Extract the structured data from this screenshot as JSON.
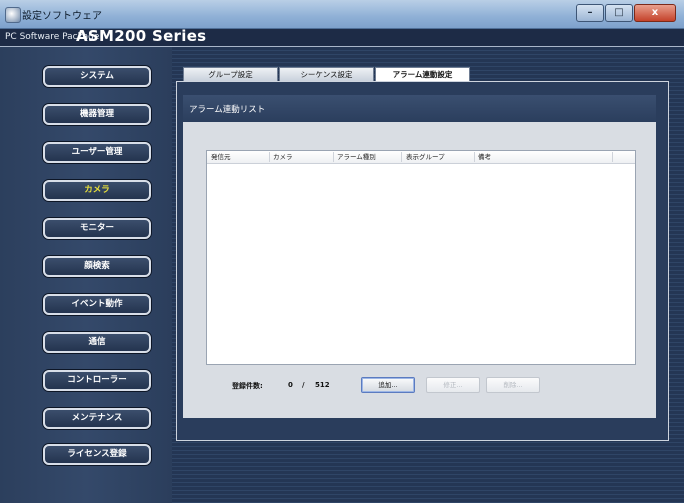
{
  "window": {
    "title": "設定ソフトウェア",
    "buttons": {
      "minimize": "–",
      "maximize": "□",
      "close": "x"
    }
  },
  "header": {
    "small": "PC Software Package",
    "big": "ASM200 Series"
  },
  "sidebar": {
    "items": [
      {
        "label": "システム"
      },
      {
        "label": "機器管理"
      },
      {
        "label": "ユーザー管理"
      },
      {
        "label": "カメラ",
        "active": true
      },
      {
        "label": "モニター"
      },
      {
        "label": "顔検索"
      },
      {
        "label": "イベント動作"
      },
      {
        "label": "通信"
      },
      {
        "label": "コントローラー"
      },
      {
        "label": "メンテナンス"
      },
      {
        "label": "ライセンス登録"
      }
    ],
    "active_color": "#e9e03a"
  },
  "tabs": [
    {
      "label": "グループ設定"
    },
    {
      "label": "シーケンス設定"
    },
    {
      "label": "アラーム連動設定",
      "active": true
    }
  ],
  "panel": {
    "title": "アラーム連動リスト",
    "columns": [
      "発信元",
      "カメラ",
      "アラーム種別",
      "表示グループ",
      "備考"
    ],
    "rows": [],
    "registered_label": "登録件数:",
    "registered_count": "0",
    "registered_max": "512",
    "buttons": {
      "add": "追加...",
      "edit": "修正...",
      "delete": "削除..."
    }
  }
}
